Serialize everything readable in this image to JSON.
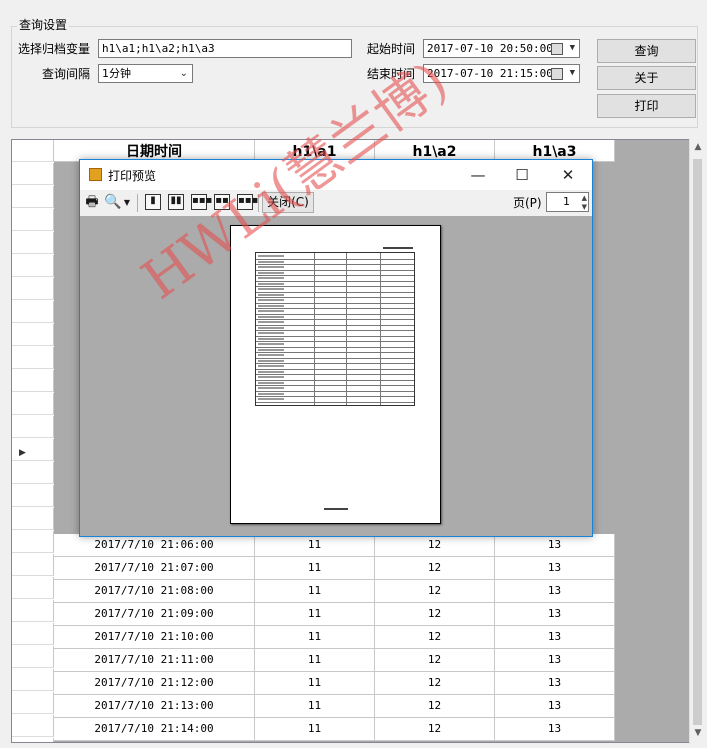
{
  "group": {
    "title": "查询设置"
  },
  "form": {
    "var_label": "选择归档变量",
    "var_value": "h1\\a1;h1\\a2;h1\\a3",
    "interval_label": "查询间隔",
    "interval_value": "1分钟",
    "start_label": "起始时间",
    "start_value": "2017-07-10 20:50:00",
    "end_label": "结束时间",
    "end_value": "2017-07-10 21:15:00"
  },
  "buttons": {
    "query": "查询",
    "about": "关于",
    "print": "打印"
  },
  "grid": {
    "columns": [
      "日期时间",
      "h1\\a1",
      "h1\\a2",
      "h1\\a3"
    ],
    "rows": [
      [
        "2017/7/10 21:06:00",
        "11",
        "12",
        "13"
      ],
      [
        "2017/7/10 21:07:00",
        "11",
        "12",
        "13"
      ],
      [
        "2017/7/10 21:08:00",
        "11",
        "12",
        "13"
      ],
      [
        "2017/7/10 21:09:00",
        "11",
        "12",
        "13"
      ],
      [
        "2017/7/10 21:10:00",
        "11",
        "12",
        "13"
      ],
      [
        "2017/7/10 21:11:00",
        "11",
        "12",
        "13"
      ],
      [
        "2017/7/10 21:12:00",
        "11",
        "12",
        "13"
      ],
      [
        "2017/7/10 21:13:00",
        "11",
        "12",
        "13"
      ],
      [
        "2017/7/10 21:14:00",
        "11",
        "12",
        "13"
      ]
    ]
  },
  "dialog": {
    "title": "打印预览",
    "close_label": "关闭(C)",
    "page_label": "页(P)",
    "page_value": "1",
    "minimize": "—",
    "maximize": "☐",
    "close_x": "✕"
  },
  "watermark": "HWLi(慧兰博)"
}
